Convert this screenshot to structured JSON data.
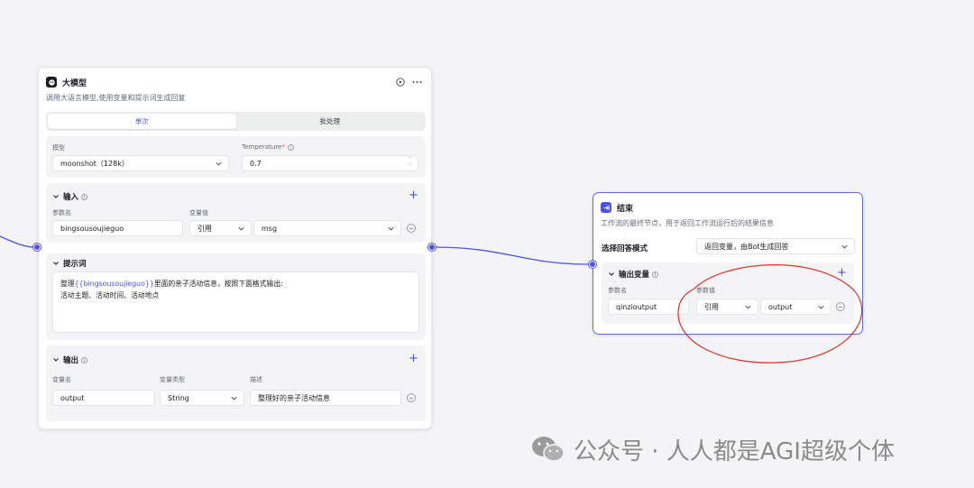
{
  "llm_node": {
    "title": "大模型",
    "description": "调用大语言模型,使用变量和提示词生成回复",
    "tabs": [
      {
        "label": "单次",
        "active": true
      },
      {
        "label": "批处理",
        "active": false
      }
    ],
    "model_label": "模型",
    "model_value": "moonshot（128k）",
    "temperature_label": "Temperature",
    "temperature_required_mark": "*",
    "temperature_value": "0.7",
    "input": {
      "title": "输入",
      "param_name_header": "参数名",
      "var_value_header": "变量值",
      "rows": [
        {
          "name": "bingsousoujieguo",
          "type": "引用",
          "value": "msg"
        }
      ]
    },
    "prompt": {
      "title": "提示词",
      "line1_pre": "整理",
      "line1_var": "{{bingsousoujieguo}}",
      "line1_post": "里面的亲子活动信息，按照下面格式输出:",
      "line2": "活动主题、活动时间、活动地点"
    },
    "output": {
      "title": "输出",
      "var_name_header": "变量名",
      "var_type_header": "变量类型",
      "desc_header": "描述",
      "rows": [
        {
          "name": "output",
          "type": "String",
          "desc": "整理好的亲子活动信息"
        }
      ]
    }
  },
  "end_node": {
    "title": "结束",
    "description": "工作流的最终节点，用于返回工作流运行后的结果信息",
    "answer_mode_label": "选择回答模式",
    "answer_mode_value": "返回变量，由Bot生成回答",
    "output_vars": {
      "title": "输出变量",
      "param_name_header": "参数名",
      "param_value_header": "参数值",
      "rows": [
        {
          "name": "qinzioutput",
          "type": "引用",
          "value": "output"
        }
      ]
    }
  },
  "watermark": {
    "text": "公众号 · 人人都是AGI超级个体"
  },
  "colors": {
    "accent": "#4d53e8",
    "edge": "#4d53e8",
    "annotation": "#e0302a",
    "canvas_bg": "#f4f4f6"
  }
}
